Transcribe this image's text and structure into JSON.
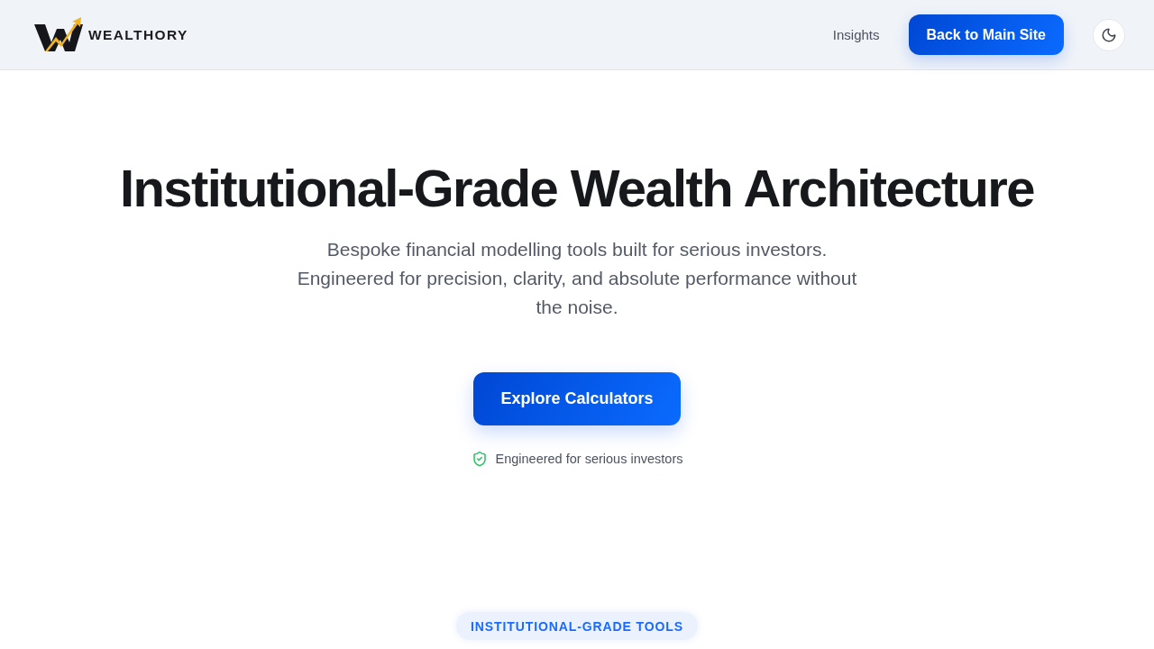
{
  "header": {
    "logo": {
      "text": "WEALTHORY"
    },
    "nav_links": [
      {
        "label": "Insights"
      }
    ],
    "cta_button": {
      "label": "Back to Main Site"
    }
  },
  "hero": {
    "title": "Institutional-Grade Wealth Architecture",
    "subtitle": "Bespoke financial modelling tools built for serious investors. Engineered for precision, clarity, and absolute performance without the noise.",
    "primary_button": {
      "label": "Explore Calculators"
    },
    "trust_note": "Engineered for serious investors"
  },
  "section_badge": {
    "label": "INSTITUTIONAL-GRADE TOOLS"
  }
}
